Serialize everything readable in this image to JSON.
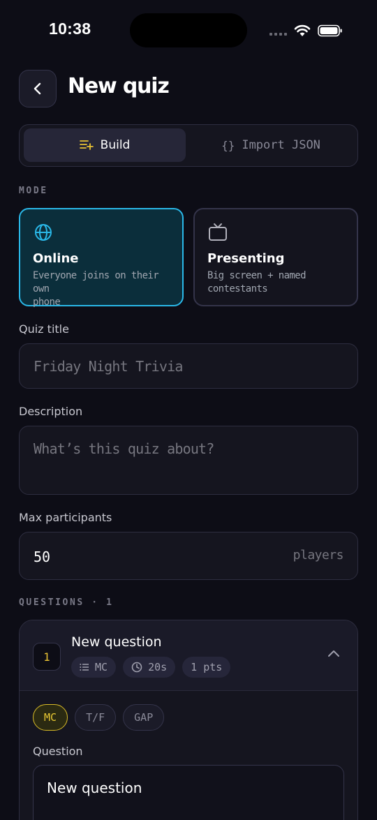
{
  "status": {
    "time": "10:38"
  },
  "header": {
    "title": "New quiz"
  },
  "tabs": {
    "build": "Build",
    "import": "Import JSON",
    "import_icon": "{}"
  },
  "mode": {
    "label": "MODE",
    "online": {
      "title": "Online",
      "desc_line1": "Everyone joins on their own",
      "desc_line2": "phone",
      "icon": "globe-icon"
    },
    "presenting": {
      "title": "Presenting",
      "desc_line1": "Big screen + named",
      "desc_line2": "contestants",
      "icon": "tv-icon"
    }
  },
  "fields": {
    "title_label": "Quiz title",
    "title_placeholder": "Friday Night Trivia",
    "description_label": "Description",
    "description_placeholder": "What’s this quiz about?",
    "max_label": "Max participants",
    "max_value": "50",
    "max_suffix": "players"
  },
  "questions": {
    "label": "QUESTIONS · 1",
    "items": [
      {
        "number": "1",
        "title": "New question",
        "chips": {
          "type": "MC",
          "time": "20s",
          "points": "1 pts"
        },
        "types": [
          "MC",
          "T/F",
          "GAP"
        ],
        "question_label": "Question",
        "question_value": "New question"
      }
    ]
  },
  "colors": {
    "accent_blue": "#2ab8e8",
    "accent_yellow": "#e8c233",
    "background": "#0d0d16"
  }
}
